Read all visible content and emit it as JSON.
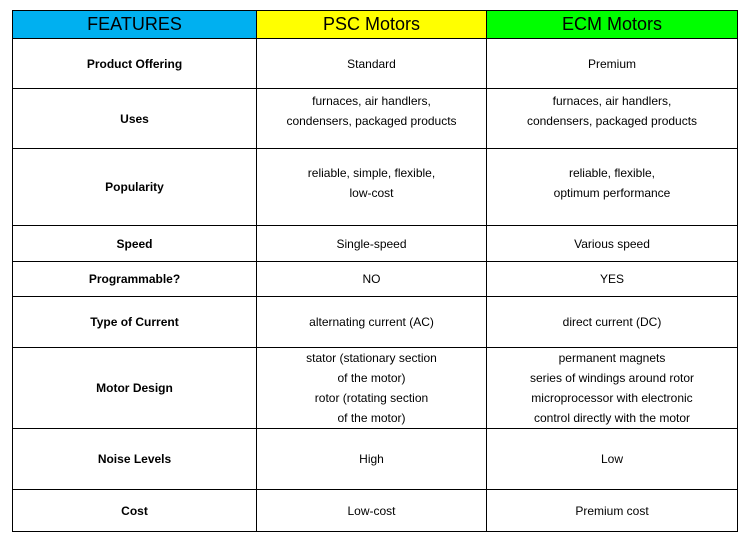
{
  "header": {
    "features": "FEATURES",
    "psc": "PSC Motors",
    "ecm": "ECM Motors"
  },
  "header_colors": {
    "features": "#00B0F0",
    "psc": "#FFFF00",
    "ecm": "#00FF00"
  },
  "rows": [
    {
      "feature": "Product Offering",
      "psc": "Standard",
      "ecm": "Premium"
    },
    {
      "feature": "Uses",
      "psc": "furnaces, air handlers,\ncondensers, packaged products",
      "ecm": "furnaces, air handlers,\ncondensers, packaged products"
    },
    {
      "feature": "Popularity",
      "psc": "reliable, simple, flexible,\nlow-cost",
      "ecm": "reliable, flexible,\noptimum performance"
    },
    {
      "feature": "Speed",
      "psc": "Single-speed",
      "ecm": "Various speed"
    },
    {
      "feature": "Programmable?",
      "psc": "NO",
      "ecm": "YES"
    },
    {
      "feature": "Type of Current",
      "psc": "alternating current (AC)",
      "ecm": "direct current (DC)"
    },
    {
      "feature": "Motor Design",
      "psc": "stator (stationary section\nof the motor)\nrotor (rotating section\nof the motor)",
      "ecm": "permanent magnets\nseries of windings around rotor\nmicroprocessor with electronic\ncontrol directly with the motor"
    },
    {
      "feature": "Noise Levels",
      "psc": "High",
      "ecm": "Low"
    },
    {
      "feature": "Cost",
      "psc": "Low-cost",
      "ecm": "Premium cost"
    }
  ]
}
